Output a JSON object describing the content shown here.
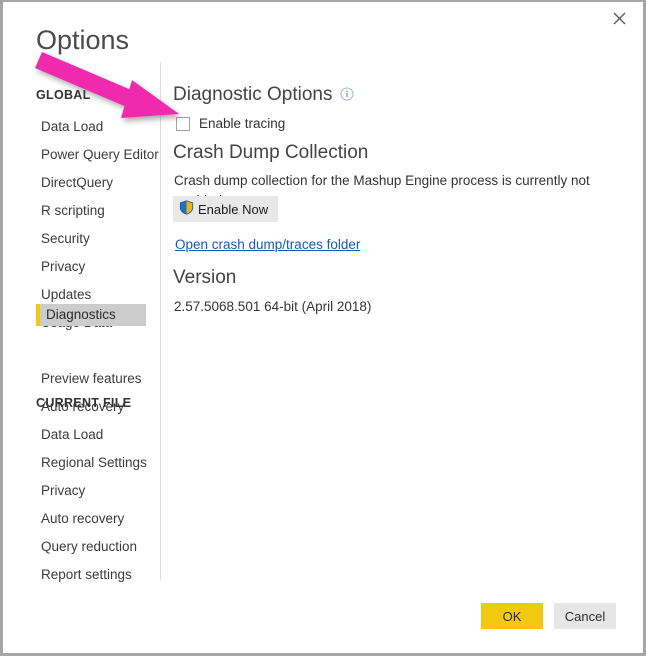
{
  "window": {
    "title": "Options",
    "close_icon": "close-icon",
    "border_color": "#a6a6a6"
  },
  "sidebar": {
    "groups": [
      {
        "heading": "GLOBAL",
        "items": [
          {
            "label": "Data Load",
            "selected": false
          },
          {
            "label": "Power Query Editor",
            "selected": false
          },
          {
            "label": "DirectQuery",
            "selected": false
          },
          {
            "label": "R scripting",
            "selected": false
          },
          {
            "label": "Security",
            "selected": false
          },
          {
            "label": "Privacy",
            "selected": false
          },
          {
            "label": "Updates",
            "selected": false
          },
          {
            "label": "Usage Data",
            "selected": false
          },
          {
            "label": "Diagnostics",
            "selected": true
          },
          {
            "label": "Preview features",
            "selected": false
          },
          {
            "label": "Auto recovery",
            "selected": false
          }
        ]
      },
      {
        "heading": "CURRENT FILE",
        "items": [
          {
            "label": "Data Load",
            "selected": false
          },
          {
            "label": "Regional Settings",
            "selected": false
          },
          {
            "label": "Privacy",
            "selected": false
          },
          {
            "label": "Auto recovery",
            "selected": false
          },
          {
            "label": "Query reduction",
            "selected": false
          },
          {
            "label": "Report settings",
            "selected": false
          }
        ]
      }
    ],
    "selected_accent": "#f2c811",
    "selected_background": "#cccccc"
  },
  "main": {
    "diagnostic_options": {
      "heading": "Diagnostic Options",
      "info_icon": "info-icon",
      "enable_tracing_label": "Enable tracing",
      "enable_tracing_checked": false
    },
    "crash_dump": {
      "heading": "Crash Dump Collection",
      "description": "Crash dump collection for the Mashup Engine process is currently not enabled.",
      "enable_now_label": "Enable Now",
      "enable_now_icon": "uac-shield-icon",
      "folder_link_label": "Open crash dump/traces folder",
      "link_color": "#1659b8"
    },
    "version": {
      "heading": "Version",
      "value": "2.57.5068.501 64-bit (April 2018)"
    }
  },
  "footer": {
    "ok_label": "OK",
    "cancel_label": "Cancel",
    "ok_color": "#f2c811",
    "cancel_color": "#e6e6e6"
  },
  "annotation": {
    "arrow_color": "#ef2bad",
    "arrow_name": "magenta-annotation-arrow",
    "points_to": "Enable tracing"
  }
}
